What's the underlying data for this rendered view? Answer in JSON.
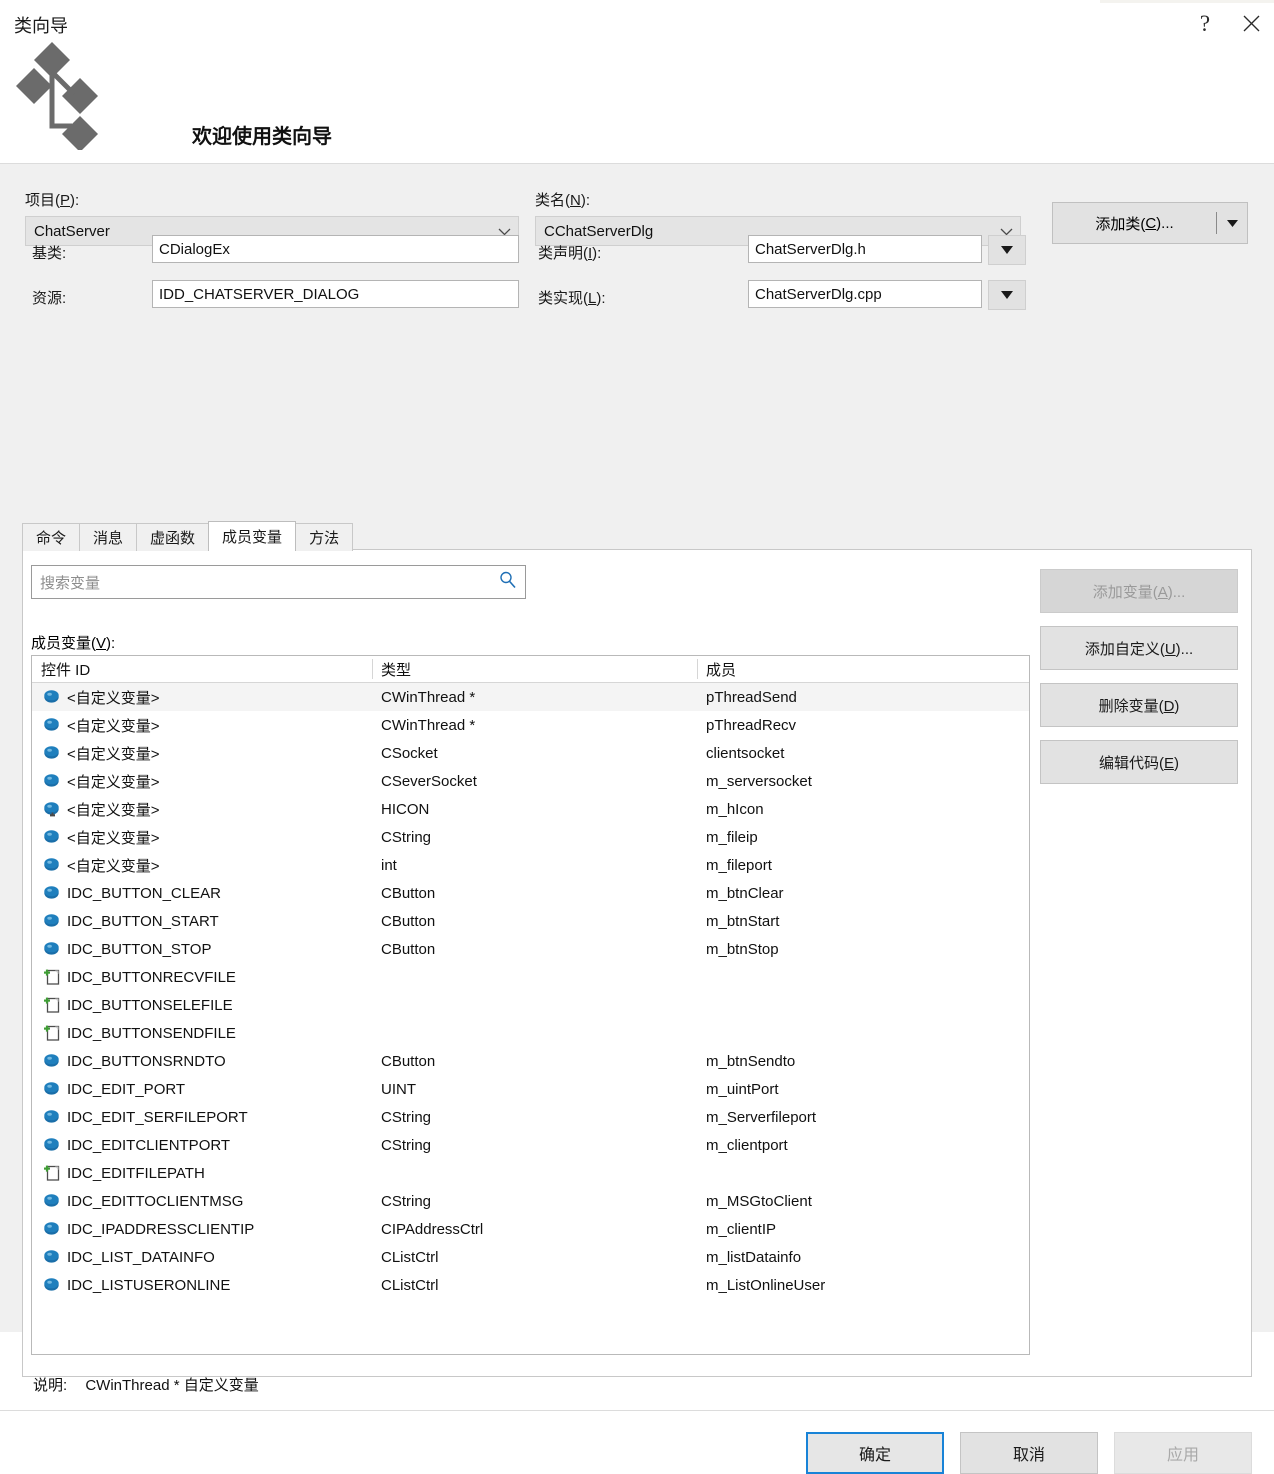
{
  "window": {
    "title": "类向导",
    "help_icon": "help-question-icon",
    "close_icon": "close-icon"
  },
  "banner": {
    "logo_icon": "class-wizard-logo-icon",
    "welcome": "欢迎使用类向导"
  },
  "form": {
    "project_label": "项目(P):",
    "project_mnemonic": "P",
    "project_value": "ChatServer",
    "class_name_label": "类名(N):",
    "class_name_mnemonic": "N",
    "class_name_value": "CChatServerDlg",
    "base_class_label": "基类:",
    "base_class_value": "CDialogEx",
    "resource_label": "资源:",
    "resource_value": "IDD_CHATSERVER_DIALOG",
    "class_decl_label": "类声明(I):",
    "class_decl_mnemonic": "I",
    "class_decl_value": "ChatServerDlg.h",
    "class_impl_label": "类实现(L):",
    "class_impl_mnemonic": "L",
    "class_impl_value": "ChatServerDlg.cpp",
    "add_class_label": "添加类(C)...",
    "add_class_mnemonic": "C",
    "chevron_icon": "chevron-down-icon",
    "dropdown_icon": "dropdown-arrow-icon"
  },
  "tabs": [
    {
      "label": "命令",
      "active": false
    },
    {
      "label": "消息",
      "active": false
    },
    {
      "label": "虚函数",
      "active": false
    },
    {
      "label": "成员变量",
      "active": true
    },
    {
      "label": "方法",
      "active": false
    }
  ],
  "panel": {
    "search_placeholder": "搜索变量",
    "search_value": "",
    "search_icon": "search-icon",
    "member_vars_label": "成员变量(V):",
    "member_vars_mnemonic": "V",
    "columns": [
      "控件 ID",
      "类型",
      "成员"
    ],
    "rows": [
      {
        "icon": "variable-cube-icon",
        "id": "<自定义变量>",
        "type": "CWinThread *",
        "member": "pThreadSend",
        "selected": true
      },
      {
        "icon": "variable-cube-icon",
        "id": "<自定义变量>",
        "type": "CWinThread *",
        "member": "pThreadRecv",
        "selected": false
      },
      {
        "icon": "variable-cube-icon",
        "id": "<自定义变量>",
        "type": "CSocket",
        "member": "clientsocket",
        "selected": false
      },
      {
        "icon": "variable-cube-icon",
        "id": "<自定义变量>",
        "type": "CSeverSocket",
        "member": "m_serversocket",
        "selected": false
      },
      {
        "icon": "variable-cube-marked-icon",
        "id": "<自定义变量>",
        "type": "HICON",
        "member": "m_hIcon",
        "selected": false
      },
      {
        "icon": "variable-cube-icon",
        "id": "<自定义变量>",
        "type": "CString",
        "member": "m_fileip",
        "selected": false
      },
      {
        "icon": "variable-cube-icon",
        "id": "<自定义变量>",
        "type": "int",
        "member": "m_fileport",
        "selected": false
      },
      {
        "icon": "variable-cube-icon",
        "id": "IDC_BUTTON_CLEAR",
        "type": "CButton",
        "member": "m_btnClear",
        "selected": false
      },
      {
        "icon": "variable-cube-icon",
        "id": "IDC_BUTTON_START",
        "type": "CButton",
        "member": "m_btnStart",
        "selected": false
      },
      {
        "icon": "variable-cube-icon",
        "id": "IDC_BUTTON_STOP",
        "type": "CButton",
        "member": "m_btnStop",
        "selected": false
      },
      {
        "icon": "add-control-icon",
        "id": "IDC_BUTTONRECVFILE",
        "type": "",
        "member": "",
        "selected": false
      },
      {
        "icon": "add-control-icon",
        "id": "IDC_BUTTONSELEFILE",
        "type": "",
        "member": "",
        "selected": false
      },
      {
        "icon": "add-control-icon",
        "id": "IDC_BUTTONSENDFILE",
        "type": "",
        "member": "",
        "selected": false
      },
      {
        "icon": "variable-cube-icon",
        "id": "IDC_BUTTONSRNDTO",
        "type": "CButton",
        "member": "m_btnSendto",
        "selected": false
      },
      {
        "icon": "variable-cube-icon",
        "id": "IDC_EDIT_PORT",
        "type": "UINT",
        "member": "m_uintPort",
        "selected": false
      },
      {
        "icon": "variable-cube-icon",
        "id": "IDC_EDIT_SERFILEPORT",
        "type": "CString",
        "member": "m_Serverfileport",
        "selected": false
      },
      {
        "icon": "variable-cube-icon",
        "id": "IDC_EDITCLIENTPORT",
        "type": "CString",
        "member": "m_clientport",
        "selected": false
      },
      {
        "icon": "add-control-icon",
        "id": "IDC_EDITFILEPATH",
        "type": "",
        "member": "",
        "selected": false
      },
      {
        "icon": "variable-cube-icon",
        "id": "IDC_EDITTOCLIENTMSG",
        "type": "CString",
        "member": "m_MSGtoClient",
        "selected": false
      },
      {
        "icon": "variable-cube-icon",
        "id": "IDC_IPADDRESSCLIENTIP",
        "type": "CIPAddressCtrl",
        "member": "m_clientIP",
        "selected": false
      },
      {
        "icon": "variable-cube-icon",
        "id": "IDC_LIST_DATAINFO",
        "type": "CListCtrl",
        "member": "m_listDatainfo",
        "selected": false
      },
      {
        "icon": "variable-cube-icon",
        "id": "IDC_LISTUSERONLINE",
        "type": "CListCtrl",
        "member": "m_ListOnlineUser",
        "selected": false
      }
    ],
    "description_label": "说明:",
    "description_text": "CWinThread * 自定义变量"
  },
  "side_buttons": [
    {
      "label": "添加变量(A)...",
      "mnemonic": "A",
      "disabled": true
    },
    {
      "label": "添加自定义(U)...",
      "mnemonic": "U",
      "disabled": false
    },
    {
      "label": "删除变量(D)",
      "mnemonic": "D",
      "disabled": false
    },
    {
      "label": "编辑代码(E)",
      "mnemonic": "E",
      "disabled": false
    }
  ],
  "footer": {
    "ok": "确定",
    "cancel": "取消",
    "apply": "应用",
    "apply_disabled": true
  },
  "colors": {
    "accent": "#1883d7",
    "icon_blue": "#1a6ea8",
    "icon_green": "#3f9d35",
    "dialog_bg": "#f0f0f0",
    "panel_bg": "#ffffff",
    "selection": "#f4f4f4"
  }
}
